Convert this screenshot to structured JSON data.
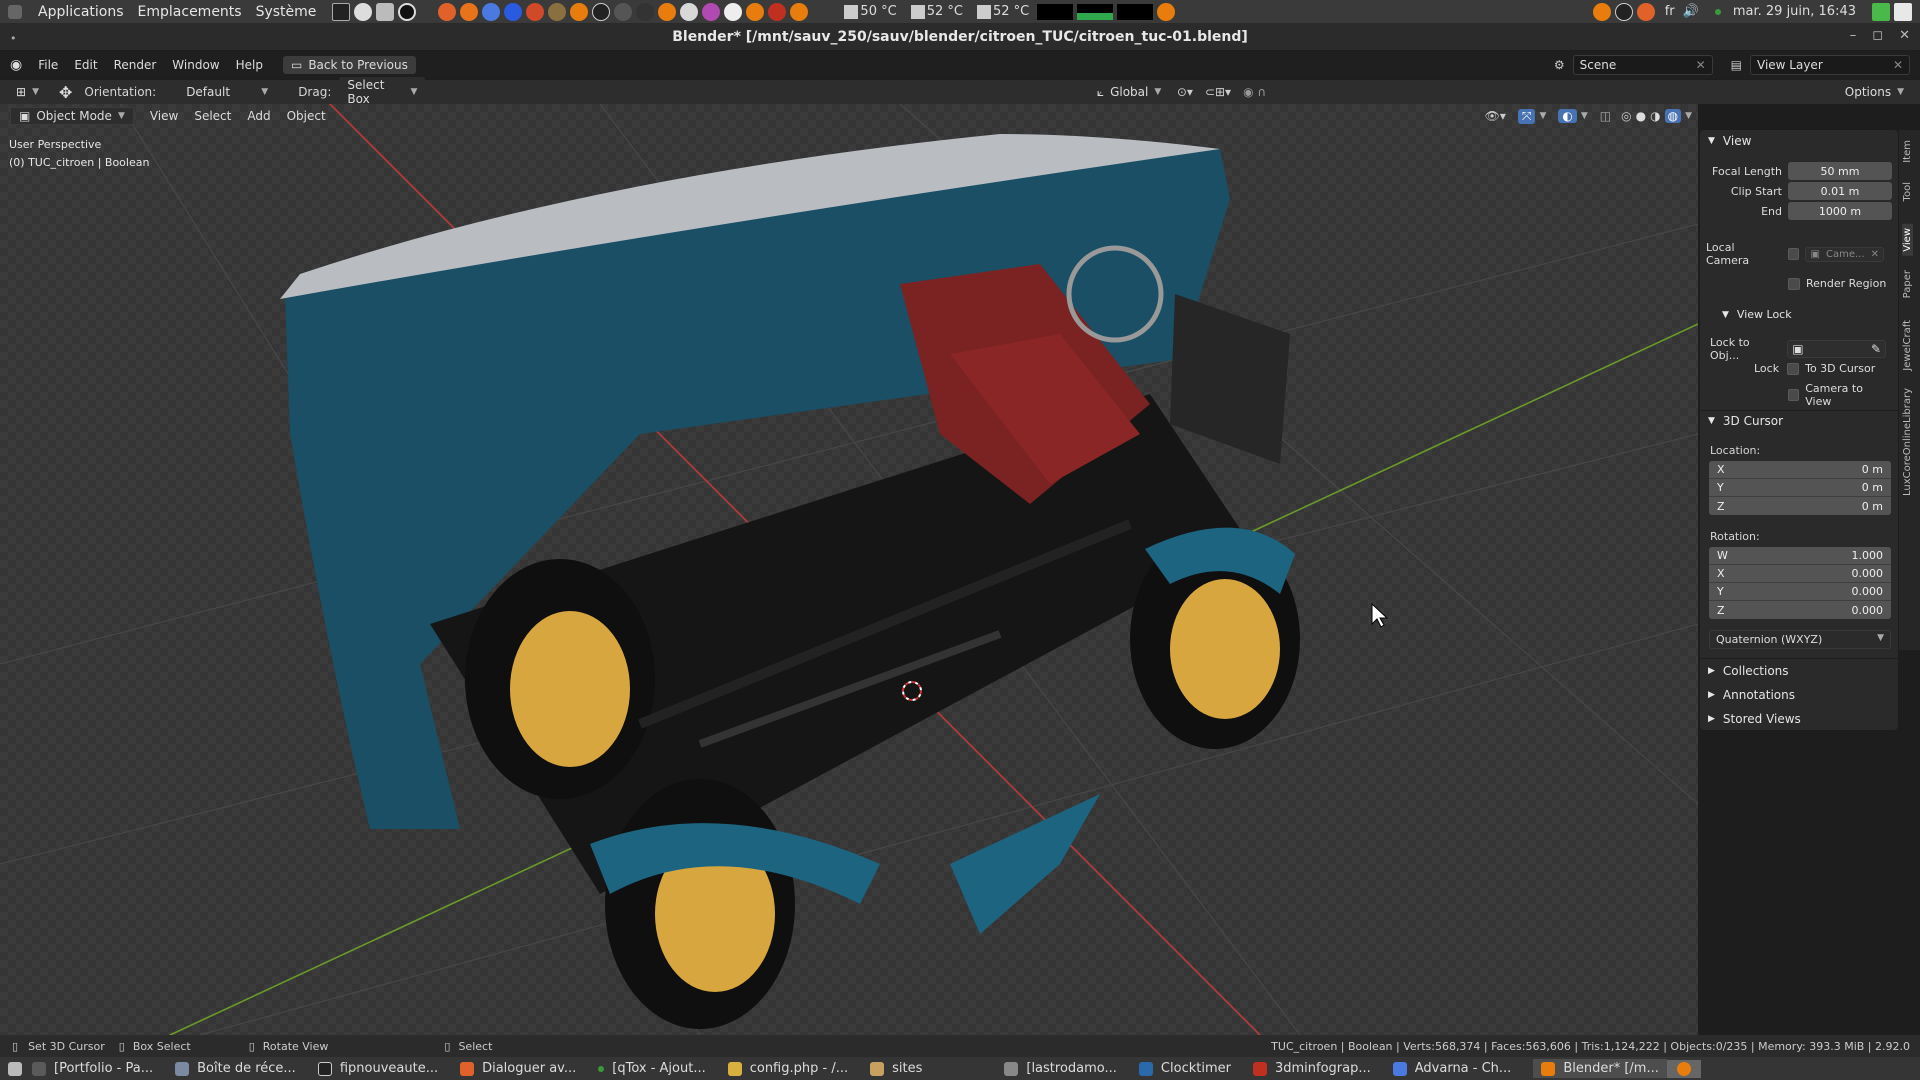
{
  "system_bar": {
    "menus": [
      "Applications",
      "Emplacements",
      "Système"
    ],
    "temps": [
      "50 °C",
      "52 °C",
      "52 °C"
    ],
    "language": "fr",
    "datetime": "mar. 29 juin, 16:43"
  },
  "window": {
    "title": "Blender* [/mnt/sauv_250/sauv/blender/citroen_TUC/citroen_tuc-01.blend]"
  },
  "menubar": {
    "items": [
      "File",
      "Edit",
      "Render",
      "Window",
      "Help"
    ],
    "back_button": "Back to Previous",
    "scene_label": "Scene",
    "view_layer_label": "View Layer"
  },
  "tool_header": {
    "orientation_label": "Orientation:",
    "orientation_value": "Default",
    "drag_label": "Drag:",
    "drag_value": "Select Box",
    "transform_orientation": "Global",
    "options_label": "Options"
  },
  "viewport_header": {
    "mode": "Object Mode",
    "menus": [
      "View",
      "Select",
      "Add",
      "Object"
    ]
  },
  "viewport_overlay": {
    "perspective": "User Perspective",
    "object_info": "(0) TUC_citroen | Boolean"
  },
  "sidebar": {
    "view_panel": {
      "title": "View",
      "focal_length_label": "Focal Length",
      "focal_length": "50 mm",
      "clip_start_label": "Clip Start",
      "clip_start": "0.01 m",
      "clip_end_label": "End",
      "clip_end": "1000 m",
      "local_camera_label": "Local Camera",
      "camera_placeholder": "Came...",
      "render_region_label": "Render Region",
      "view_lock_title": "View Lock",
      "lock_to_obj_label": "Lock to Obj...",
      "lock_label": "Lock",
      "to_3d_cursor_label": "To 3D Cursor",
      "camera_to_view_label": "Camera to View"
    },
    "cursor_panel": {
      "title": "3D Cursor",
      "location_label": "Location:",
      "location": [
        {
          "axis": "X",
          "value": "0 m"
        },
        {
          "axis": "Y",
          "value": "0 m"
        },
        {
          "axis": "Z",
          "value": "0 m"
        }
      ],
      "rotation_label": "Rotation:",
      "rotation": [
        {
          "axis": "W",
          "value": "1.000"
        },
        {
          "axis": "X",
          "value": "0.000"
        },
        {
          "axis": "Y",
          "value": "0.000"
        },
        {
          "axis": "Z",
          "value": "0.000"
        }
      ],
      "rotation_mode": "Quaternion (WXYZ)"
    },
    "collapsed_panels": [
      "Collections",
      "Annotations",
      "Stored Views"
    ],
    "tabs": [
      "Item",
      "Tool",
      "View",
      "Paper",
      "JewelCraft",
      "LuxCoreOnlineLibrary"
    ]
  },
  "status_bar": {
    "hints": [
      "Set 3D Cursor",
      "Box Select",
      "Rotate View",
      "Select"
    ],
    "stats": "TUC_citroen | Boolean | Verts:568,374 | Faces:563,606 | Tris:1,124,222 | Objects:0/235 | Memory: 393.3 MiB | 2.92.0"
  },
  "taskbar": {
    "tasks": [
      {
        "label": "[Portfolio - Pa...",
        "color": "#5a5a5a"
      },
      {
        "label": "Boîte de réce...",
        "color": "#7a8aa0"
      },
      {
        "label": "fipnouveaute...",
        "color": "#222222"
      },
      {
        "label": "Dialoguer av...",
        "color": "#e0622a"
      },
      {
        "label": "[qTox - Ajout...",
        "color": "#3a9a3a"
      },
      {
        "label": "config.php - /...",
        "color": "#d8b040"
      },
      {
        "label": "sites",
        "color": "#c8a060"
      },
      {
        "label": "[lastrodamo...",
        "color": "#888888"
      },
      {
        "label": "Clocktimer",
        "color": "#2a6aaa"
      },
      {
        "label": "3dminfograp...",
        "color": "#c03020"
      },
      {
        "label": "Advarna - Ch...",
        "color": "#4a7ae0"
      },
      {
        "label": "Blender* [/m...",
        "color": "#e87d0d"
      }
    ]
  }
}
